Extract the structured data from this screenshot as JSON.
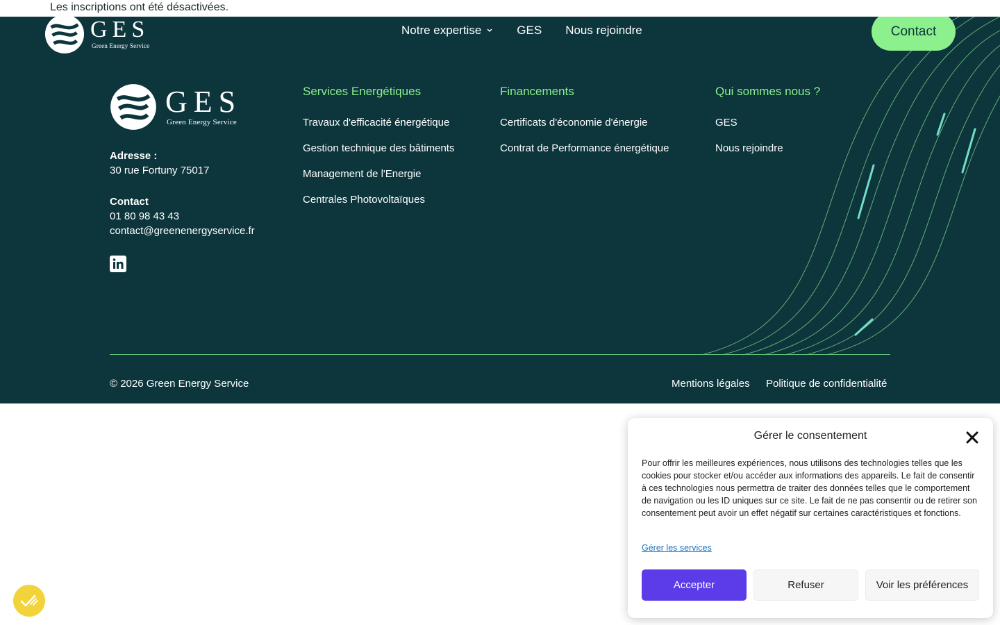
{
  "notice": "Les inscriptions ont été désactivées.",
  "brand": {
    "name": "GES",
    "tagline": "Green Energy Service"
  },
  "nav": {
    "items": [
      {
        "label": "Notre expertise"
      },
      {
        "label": "GES"
      },
      {
        "label": "Nous rejoindre"
      }
    ],
    "contact_label": "Contact"
  },
  "info": {
    "address_label": "Adresse :",
    "address": "30 rue Fortuny 75017",
    "contact_label": "Contact",
    "phone": "01 80 98 43 43",
    "email": "contact@greenenergyservice.fr"
  },
  "columns": [
    {
      "title": "Services Energétiques",
      "links": [
        "Travaux d'efficacité énergétique",
        "Gestion technique des bâtiments",
        "Management de l'Energie",
        "Centrales Photovoltaïques"
      ]
    },
    {
      "title": "Financements",
      "links": [
        "Certificats d'économie d'énergie",
        "Contrat de Performance énergétique"
      ]
    },
    {
      "title": "Qui sommes nous ?",
      "links": [
        "GES",
        "Nous rejoindre"
      ]
    }
  ],
  "bottom": {
    "copyright": "© 2026 Green Energy Service",
    "legal": "Mentions légales",
    "privacy": "Politique de confidentialité"
  },
  "consent": {
    "title": "Gérer le consentement",
    "body": "Pour offrir les meilleures expériences, nous utilisons des technologies telles que les cookies pour stocker et/ou accéder aux informations des appareils. Le fait de consentir à ces technologies nous permettra de traiter des données telles que le comportement de navigation ou les ID uniques sur ce site. Le fait de ne pas consentir ou de retirer son consentement peut avoir un effet négatif sur certaines caractéristiques et fonctions.",
    "manage_label": "Gérer les services",
    "accept_label": "Accepter",
    "refuse_label": "Refuser",
    "prefs_label": "Voir les préférences"
  },
  "colors": {
    "footer_bg": "#0c353c",
    "accent_green": "#8cf08c",
    "accept_purple": "#5b3ce8",
    "badge_yellow": "#f2d33a"
  },
  "icons": [
    "ges-logo-icon",
    "chevron-down-icon",
    "linkedin-icon",
    "close-icon",
    "cookie-badge-icon"
  ]
}
